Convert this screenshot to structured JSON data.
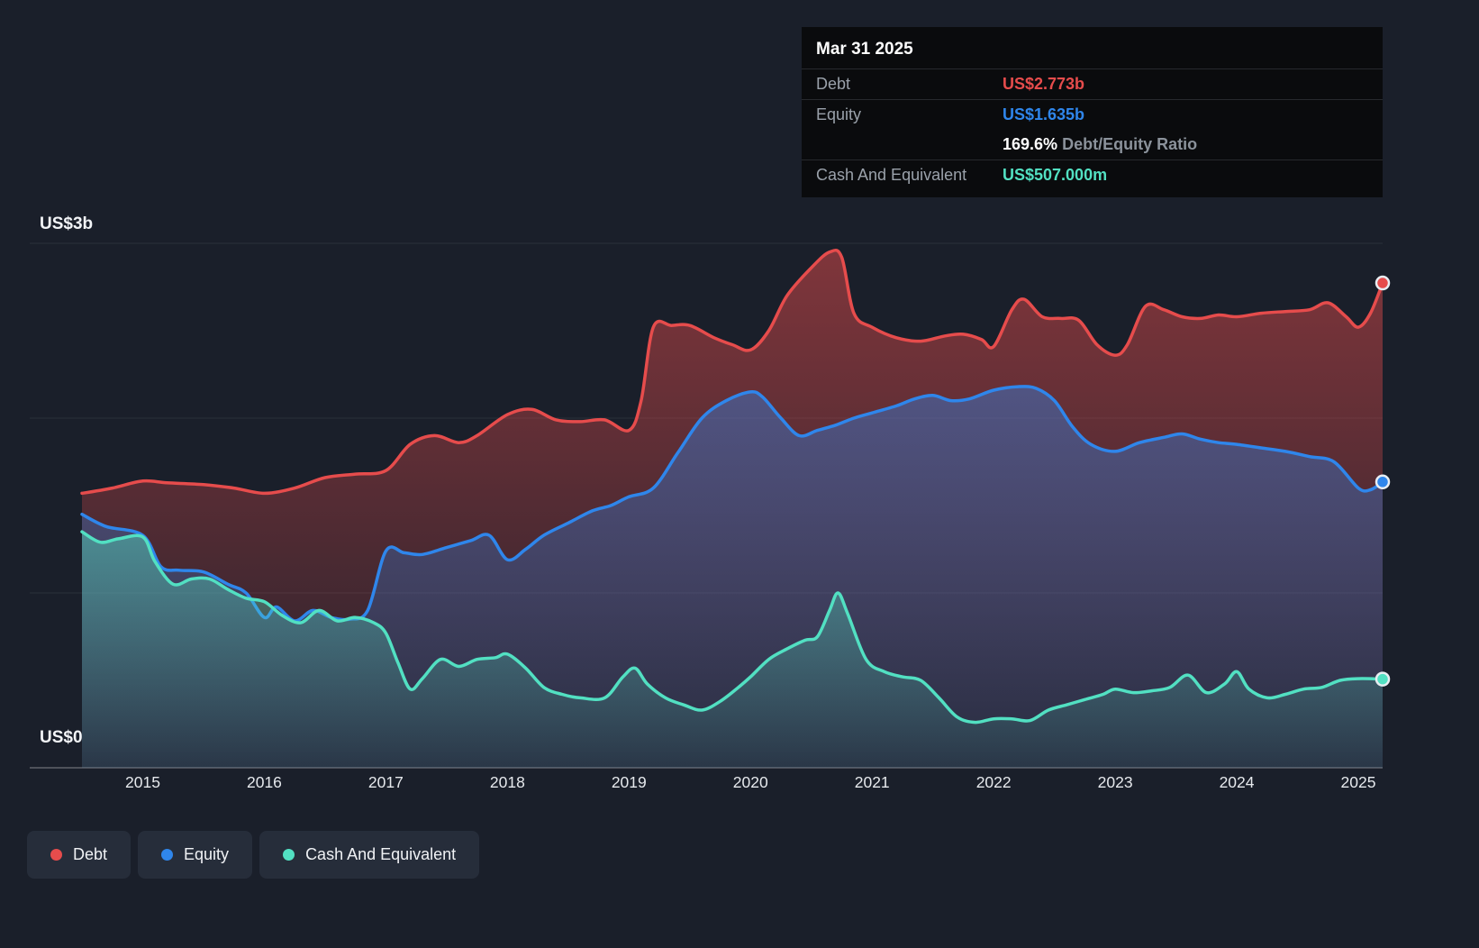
{
  "colors": {
    "debt": "#e64c4c",
    "equity": "#2f86eb",
    "cash": "#52e0c2",
    "background": "#1a1f2a"
  },
  "tooltip": {
    "date": "Mar 31 2025",
    "debt_label": "Debt",
    "debt_value": "US$2.773b",
    "equity_label": "Equity",
    "equity_value": "US$1.635b",
    "ratio_value": "169.6%",
    "ratio_label": "Debt/Equity Ratio",
    "cash_label": "Cash And Equivalent",
    "cash_value": "US$507.000m"
  },
  "axis": {
    "y_top_label": "US$3b",
    "y_bottom_label": "US$0"
  },
  "legend": [
    "Debt",
    "Equity",
    "Cash And Equivalent"
  ],
  "chart_data": {
    "type": "area",
    "title": "",
    "xlabel": "",
    "ylabel": "",
    "xlim": [
      2014.07,
      2025.2
    ],
    "ylim": [
      0,
      3
    ],
    "x_ticks": [
      2015,
      2016,
      2017,
      2018,
      2019,
      2020,
      2021,
      2022,
      2023,
      2024,
      2025
    ],
    "y_gridlines": [
      0,
      1,
      2,
      3
    ],
    "y_tick_labels": [
      {
        "value": 3,
        "label": "US$3b"
      },
      {
        "value": 0,
        "label": "US$0"
      }
    ],
    "legend_position": "bottom-left",
    "series": [
      {
        "name": "Debt",
        "color": "#e64c4c",
        "final_label": "US$2.773b",
        "points": [
          [
            2014.5,
            1.57
          ],
          [
            2014.75,
            1.6
          ],
          [
            2015.0,
            1.64
          ],
          [
            2015.2,
            1.63
          ],
          [
            2015.5,
            1.62
          ],
          [
            2015.75,
            1.6
          ],
          [
            2016.0,
            1.57
          ],
          [
            2016.25,
            1.6
          ],
          [
            2016.5,
            1.66
          ],
          [
            2016.75,
            1.68
          ],
          [
            2017.0,
            1.7
          ],
          [
            2017.2,
            1.85
          ],
          [
            2017.4,
            1.9
          ],
          [
            2017.6,
            1.86
          ],
          [
            2017.75,
            1.9
          ],
          [
            2018.0,
            2.02
          ],
          [
            2018.2,
            2.05
          ],
          [
            2018.4,
            1.99
          ],
          [
            2018.6,
            1.98
          ],
          [
            2018.8,
            1.99
          ],
          [
            2019.0,
            1.93
          ],
          [
            2019.1,
            2.1
          ],
          [
            2019.2,
            2.52
          ],
          [
            2019.35,
            2.53
          ],
          [
            2019.5,
            2.53
          ],
          [
            2019.7,
            2.46
          ],
          [
            2019.85,
            2.42
          ],
          [
            2020.0,
            2.39
          ],
          [
            2020.15,
            2.5
          ],
          [
            2020.3,
            2.7
          ],
          [
            2020.5,
            2.86
          ],
          [
            2020.65,
            2.95
          ],
          [
            2020.75,
            2.92
          ],
          [
            2020.85,
            2.6
          ],
          [
            2021.0,
            2.52
          ],
          [
            2021.2,
            2.46
          ],
          [
            2021.4,
            2.44
          ],
          [
            2021.6,
            2.47
          ],
          [
            2021.75,
            2.48
          ],
          [
            2021.9,
            2.45
          ],
          [
            2022.0,
            2.41
          ],
          [
            2022.15,
            2.62
          ],
          [
            2022.25,
            2.68
          ],
          [
            2022.4,
            2.58
          ],
          [
            2022.55,
            2.57
          ],
          [
            2022.7,
            2.56
          ],
          [
            2022.85,
            2.42
          ],
          [
            2023.0,
            2.36
          ],
          [
            2023.1,
            2.42
          ],
          [
            2023.25,
            2.64
          ],
          [
            2023.4,
            2.62
          ],
          [
            2023.55,
            2.58
          ],
          [
            2023.7,
            2.57
          ],
          [
            2023.85,
            2.59
          ],
          [
            2024.0,
            2.58
          ],
          [
            2024.2,
            2.6
          ],
          [
            2024.4,
            2.61
          ],
          [
            2024.6,
            2.62
          ],
          [
            2024.75,
            2.66
          ],
          [
            2024.9,
            2.58
          ],
          [
            2025.0,
            2.52
          ],
          [
            2025.1,
            2.6
          ],
          [
            2025.2,
            2.773
          ]
        ]
      },
      {
        "name": "Equity",
        "color": "#2f86eb",
        "final_label": "US$1.635b",
        "points": [
          [
            2014.5,
            1.45
          ],
          [
            2014.7,
            1.38
          ],
          [
            2015.0,
            1.33
          ],
          [
            2015.15,
            1.15
          ],
          [
            2015.3,
            1.13
          ],
          [
            2015.5,
            1.12
          ],
          [
            2015.7,
            1.05
          ],
          [
            2015.85,
            1.0
          ],
          [
            2016.0,
            0.86
          ],
          [
            2016.1,
            0.92
          ],
          [
            2016.25,
            0.84
          ],
          [
            2016.4,
            0.9
          ],
          [
            2016.55,
            0.86
          ],
          [
            2016.7,
            0.85
          ],
          [
            2016.85,
            0.9
          ],
          [
            2017.0,
            1.24
          ],
          [
            2017.15,
            1.23
          ],
          [
            2017.3,
            1.22
          ],
          [
            2017.5,
            1.26
          ],
          [
            2017.7,
            1.3
          ],
          [
            2017.85,
            1.33
          ],
          [
            2018.0,
            1.19
          ],
          [
            2018.15,
            1.25
          ],
          [
            2018.3,
            1.33
          ],
          [
            2018.5,
            1.4
          ],
          [
            2018.7,
            1.47
          ],
          [
            2018.85,
            1.5
          ],
          [
            2019.0,
            1.55
          ],
          [
            2019.2,
            1.6
          ],
          [
            2019.4,
            1.8
          ],
          [
            2019.6,
            2.0
          ],
          [
            2019.8,
            2.1
          ],
          [
            2020.0,
            2.15
          ],
          [
            2020.1,
            2.12
          ],
          [
            2020.25,
            2.0
          ],
          [
            2020.4,
            1.9
          ],
          [
            2020.55,
            1.93
          ],
          [
            2020.7,
            1.96
          ],
          [
            2020.85,
            2.0
          ],
          [
            2021.0,
            2.03
          ],
          [
            2021.2,
            2.07
          ],
          [
            2021.35,
            2.11
          ],
          [
            2021.5,
            2.13
          ],
          [
            2021.65,
            2.1
          ],
          [
            2021.8,
            2.11
          ],
          [
            2022.0,
            2.16
          ],
          [
            2022.2,
            2.18
          ],
          [
            2022.35,
            2.17
          ],
          [
            2022.5,
            2.1
          ],
          [
            2022.65,
            1.95
          ],
          [
            2022.8,
            1.85
          ],
          [
            2023.0,
            1.81
          ],
          [
            2023.2,
            1.86
          ],
          [
            2023.4,
            1.89
          ],
          [
            2023.55,
            1.91
          ],
          [
            2023.7,
            1.88
          ],
          [
            2023.85,
            1.86
          ],
          [
            2024.0,
            1.85
          ],
          [
            2024.2,
            1.83
          ],
          [
            2024.4,
            1.81
          ],
          [
            2024.6,
            1.78
          ],
          [
            2024.8,
            1.75
          ],
          [
            2025.0,
            1.6
          ],
          [
            2025.1,
            1.59
          ],
          [
            2025.2,
            1.635
          ]
        ]
      },
      {
        "name": "Cash And Equivalent",
        "color": "#52e0c2",
        "final_label": "US$507.000m",
        "points": [
          [
            2014.5,
            1.35
          ],
          [
            2014.65,
            1.29
          ],
          [
            2014.8,
            1.31
          ],
          [
            2015.0,
            1.32
          ],
          [
            2015.1,
            1.18
          ],
          [
            2015.25,
            1.05
          ],
          [
            2015.4,
            1.08
          ],
          [
            2015.55,
            1.08
          ],
          [
            2015.7,
            1.02
          ],
          [
            2015.85,
            0.97
          ],
          [
            2016.0,
            0.95
          ],
          [
            2016.15,
            0.87
          ],
          [
            2016.3,
            0.83
          ],
          [
            2016.45,
            0.9
          ],
          [
            2016.6,
            0.84
          ],
          [
            2016.75,
            0.86
          ],
          [
            2016.9,
            0.83
          ],
          [
            2017.0,
            0.77
          ],
          [
            2017.1,
            0.6
          ],
          [
            2017.2,
            0.45
          ],
          [
            2017.3,
            0.51
          ],
          [
            2017.45,
            0.62
          ],
          [
            2017.6,
            0.58
          ],
          [
            2017.75,
            0.62
          ],
          [
            2017.9,
            0.63
          ],
          [
            2018.0,
            0.65
          ],
          [
            2018.15,
            0.57
          ],
          [
            2018.3,
            0.46
          ],
          [
            2018.45,
            0.42
          ],
          [
            2018.6,
            0.4
          ],
          [
            2018.8,
            0.4
          ],
          [
            2018.95,
            0.52
          ],
          [
            2019.05,
            0.57
          ],
          [
            2019.15,
            0.48
          ],
          [
            2019.3,
            0.4
          ],
          [
            2019.45,
            0.36
          ],
          [
            2019.6,
            0.33
          ],
          [
            2019.75,
            0.38
          ],
          [
            2019.9,
            0.46
          ],
          [
            2020.0,
            0.52
          ],
          [
            2020.15,
            0.62
          ],
          [
            2020.3,
            0.68
          ],
          [
            2020.45,
            0.73
          ],
          [
            2020.55,
            0.75
          ],
          [
            2020.65,
            0.9
          ],
          [
            2020.72,
            1.0
          ],
          [
            2020.8,
            0.88
          ],
          [
            2020.95,
            0.62
          ],
          [
            2021.1,
            0.55
          ],
          [
            2021.25,
            0.52
          ],
          [
            2021.4,
            0.5
          ],
          [
            2021.55,
            0.4
          ],
          [
            2021.7,
            0.29
          ],
          [
            2021.85,
            0.26
          ],
          [
            2022.0,
            0.28
          ],
          [
            2022.15,
            0.28
          ],
          [
            2022.3,
            0.27
          ],
          [
            2022.45,
            0.33
          ],
          [
            2022.6,
            0.36
          ],
          [
            2022.75,
            0.39
          ],
          [
            2022.9,
            0.42
          ],
          [
            2023.0,
            0.45
          ],
          [
            2023.15,
            0.43
          ],
          [
            2023.3,
            0.44
          ],
          [
            2023.45,
            0.46
          ],
          [
            2023.6,
            0.53
          ],
          [
            2023.75,
            0.43
          ],
          [
            2023.9,
            0.48
          ],
          [
            2024.0,
            0.55
          ],
          [
            2024.1,
            0.45
          ],
          [
            2024.25,
            0.4
          ],
          [
            2024.4,
            0.42
          ],
          [
            2024.55,
            0.45
          ],
          [
            2024.7,
            0.46
          ],
          [
            2024.85,
            0.5
          ],
          [
            2025.0,
            0.51
          ],
          [
            2025.2,
            0.507
          ]
        ]
      }
    ]
  }
}
